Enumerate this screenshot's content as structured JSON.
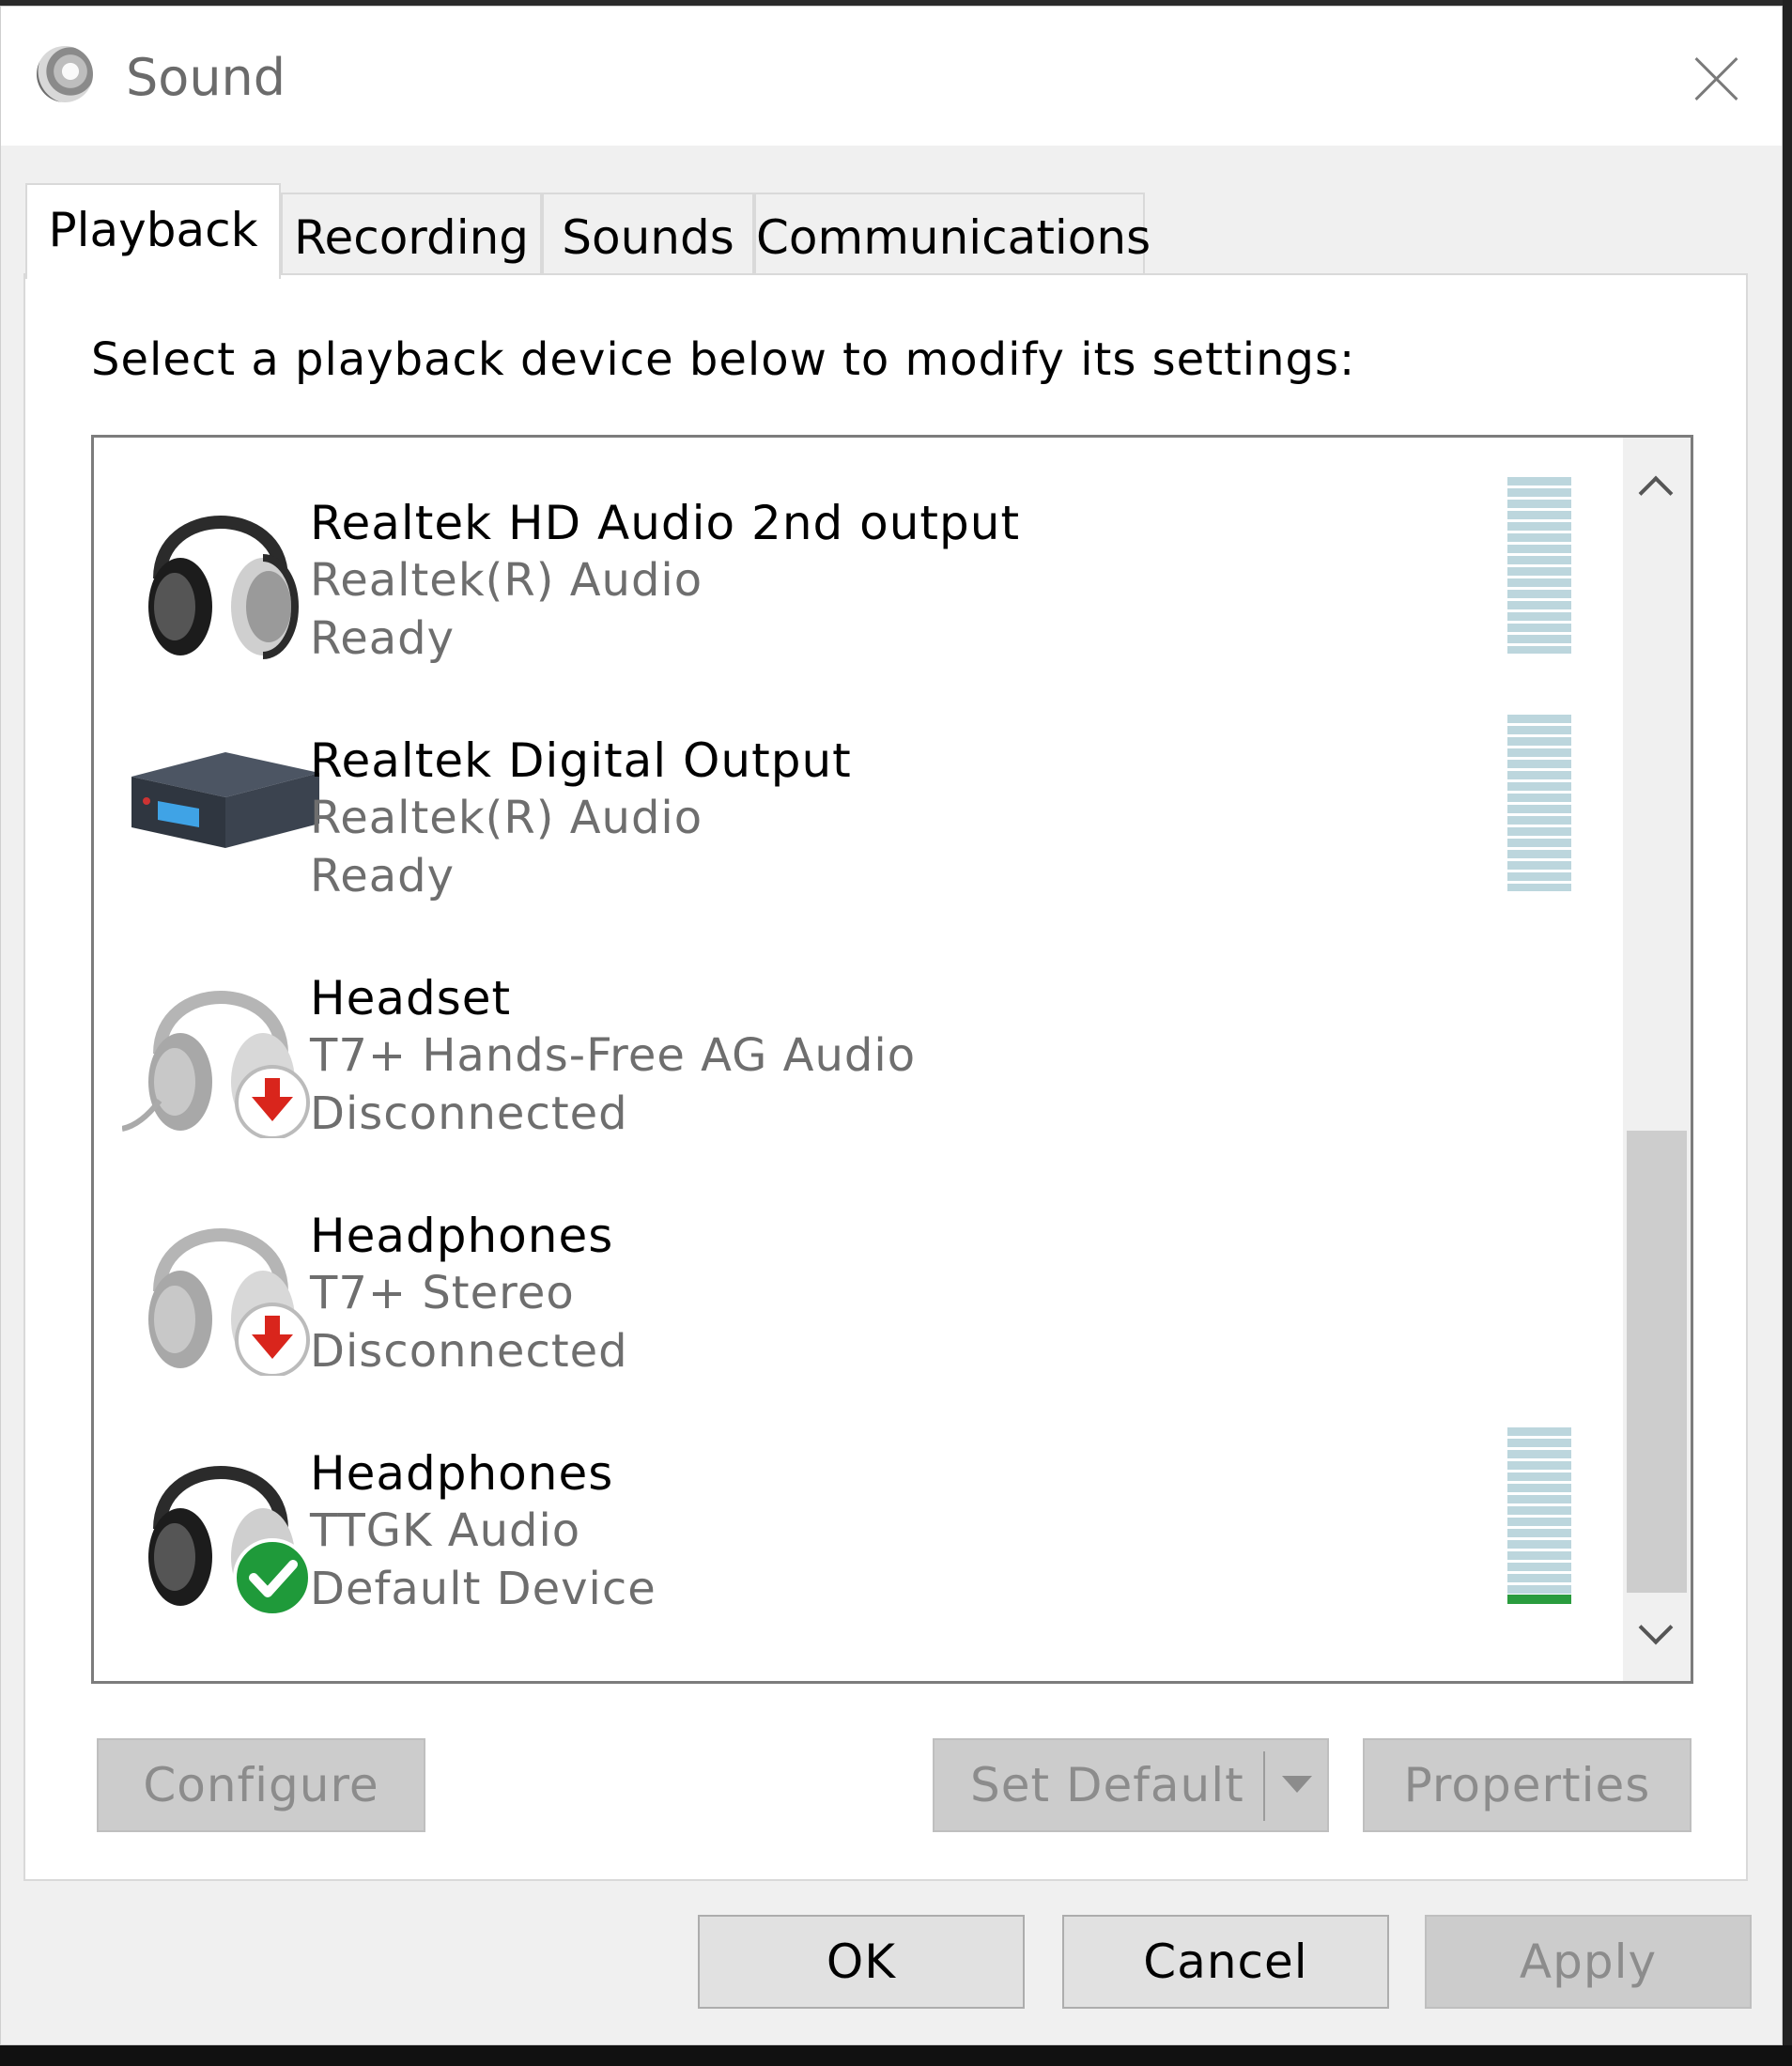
{
  "window": {
    "title": "Sound",
    "app_icon": "speaker-icon",
    "close_icon": "close-icon"
  },
  "tabs": [
    {
      "label": "Playback",
      "active": true
    },
    {
      "label": "Recording",
      "active": false
    },
    {
      "label": "Sounds",
      "active": false
    },
    {
      "label": "Communications",
      "active": false
    }
  ],
  "playback": {
    "instruction": "Select a playback device below to modify its settings:",
    "devices": [
      {
        "name": "Realtek HD Audio 2nd output",
        "driver": "Realtek(R) Audio",
        "status": "Ready",
        "icon": "headphones-icon",
        "badge": null
      },
      {
        "name": "Realtek Digital Output",
        "driver": "Realtek(R) Audio",
        "status": "Ready",
        "icon": "digital-output-receiver-icon",
        "badge": null
      },
      {
        "name": "Headset",
        "driver": "T7+ Hands-Free AG Audio",
        "status": "Disconnected",
        "icon": "headset-icon",
        "badge": "disconnected-arrow-icon"
      },
      {
        "name": "Headphones",
        "driver": "T7+ Stereo",
        "status": "Disconnected",
        "icon": "headphones-icon",
        "badge": "disconnected-arrow-icon"
      },
      {
        "name": "Headphones",
        "driver": "TTGK Audio",
        "status": "Default Device",
        "icon": "headphones-icon",
        "badge": "default-check-icon"
      }
    ],
    "buttons": {
      "configure": "Configure",
      "set_default": "Set Default",
      "properties": "Properties"
    }
  },
  "footer": {
    "ok": "OK",
    "cancel": "Cancel",
    "apply": "Apply"
  },
  "colors": {
    "meter_idle": "#bcd6dd",
    "meter_active": "#2a9c3e",
    "disconnected_badge": "#d9251c",
    "default_badge": "#1f9a3a"
  }
}
